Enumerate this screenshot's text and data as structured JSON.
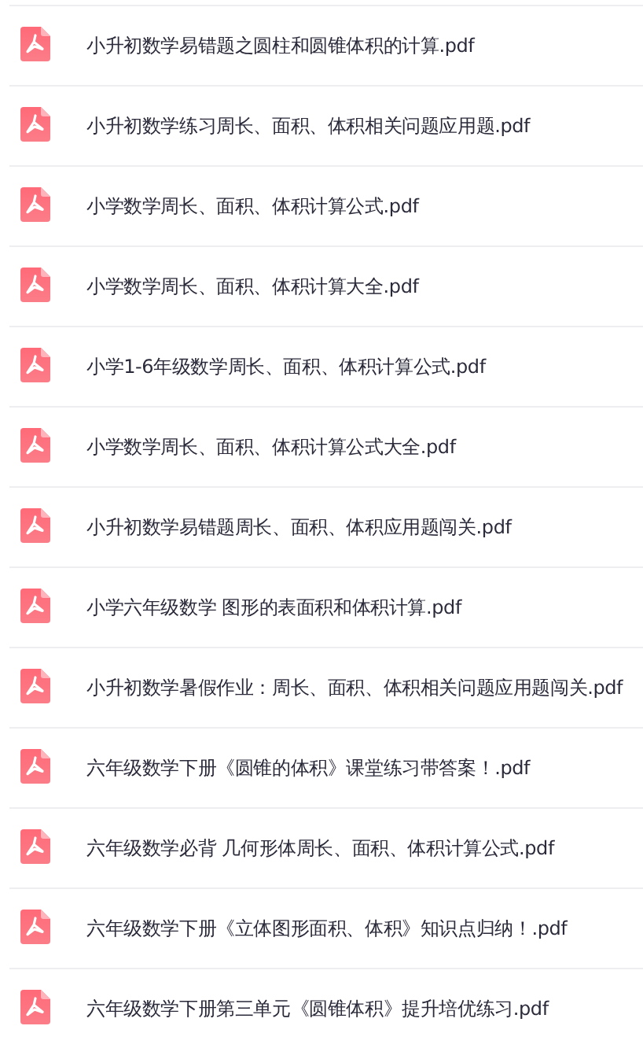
{
  "files": [
    {
      "name": "小升初数学易错题之圆柱和圆锥体积的计算.pdf"
    },
    {
      "name": "小升初数学练习周长、面积、体积相关问题应用题.pdf"
    },
    {
      "name": "小学数学周长、面积、体积计算公式.pdf"
    },
    {
      "name": "小学数学周长、面积、体积计算大全.pdf"
    },
    {
      "name": "小学1-6年级数学周长、面积、体积计算公式.pdf"
    },
    {
      "name": "小学数学周长、面积、体积计算公式大全.pdf"
    },
    {
      "name": "小升初数学易错题周长、面积、体积应用题闯关.pdf"
    },
    {
      "name": "小学六年级数学 图形的表面积和体积计算.pdf"
    },
    {
      "name": "小升初数学暑假作业：周长、面积、体积相关问题应用题闯关.pdf"
    },
    {
      "name": "六年级数学下册《圆锥的体积》课堂练习带答案！.pdf"
    },
    {
      "name": "六年级数学必背 几何形体周长、面积、体积计算公式.pdf"
    },
    {
      "name": "六年级数学下册《立体图形面积、体积》知识点归纳！.pdf"
    },
    {
      "name": "六年级数学下册第三单元《圆锥体积》提升培优练习.pdf"
    }
  ]
}
